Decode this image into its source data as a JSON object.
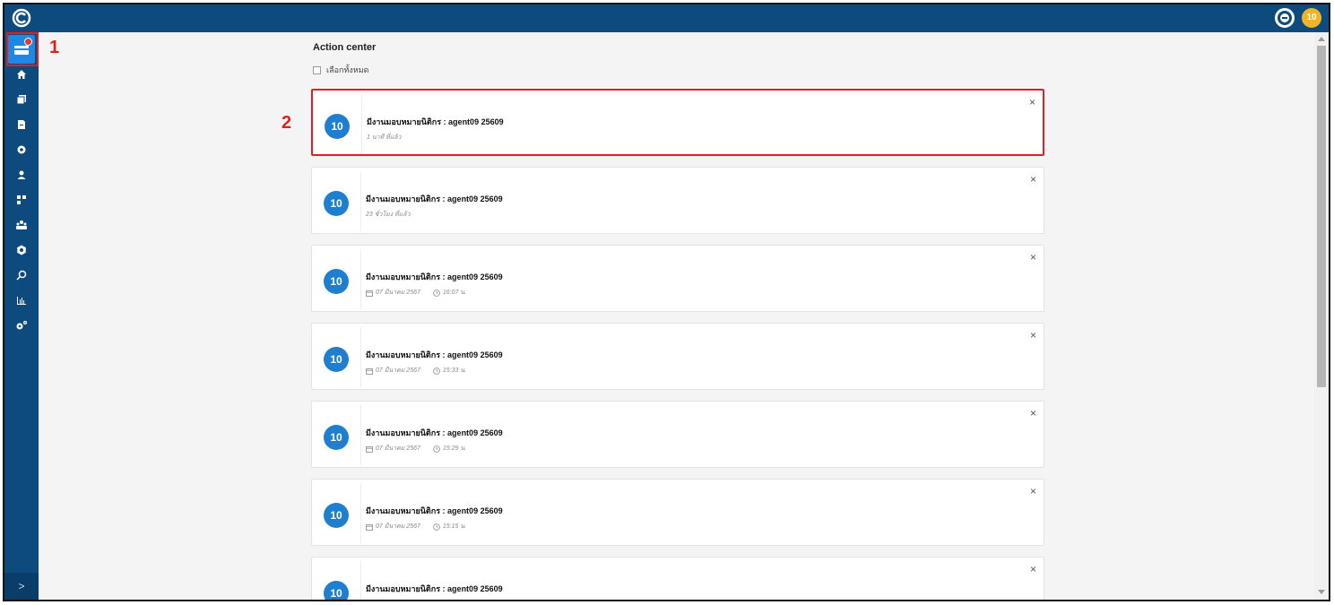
{
  "app": {
    "logo_letter": "C",
    "user_initials": "10"
  },
  "sidebar": {
    "items": [
      {
        "icon": "inbox-icon"
      },
      {
        "icon": "home-icon"
      },
      {
        "icon": "copy-icon"
      },
      {
        "icon": "file-icon"
      },
      {
        "icon": "settings-cog-icon"
      },
      {
        "icon": "user-icon"
      },
      {
        "icon": "grid-icon"
      },
      {
        "icon": "group-icon"
      },
      {
        "icon": "gear-icon"
      },
      {
        "icon": "search-icon"
      },
      {
        "icon": "chart-icon"
      },
      {
        "icon": "cogs-icon"
      }
    ],
    "expand_label": ">"
  },
  "annotations": {
    "label1": "1",
    "label2": "2"
  },
  "main": {
    "title": "Action center",
    "select_all_label": "เลือกทั้งหมด",
    "close_symbol": "×",
    "cards": [
      {
        "avatar": "10",
        "title": "มีงานมอบหมายนิติกร : agent09 25609",
        "time_ago": "1 นาที ที่แล้ว",
        "date": "",
        "time": ""
      },
      {
        "avatar": "10",
        "title": "มีงานมอบหมายนิติกร : agent09 25609",
        "time_ago": "23 ชั่วโมง ที่แล้ว",
        "date": "",
        "time": ""
      },
      {
        "avatar": "10",
        "title": "มีงานมอบหมายนิติกร : agent09 25609",
        "time_ago": "",
        "date": "07 มีนาคม 2567",
        "time": "16:07 น."
      },
      {
        "avatar": "10",
        "title": "มีงานมอบหมายนิติกร : agent09 25609",
        "time_ago": "",
        "date": "07 มีนาคม 2567",
        "time": "15:33 น."
      },
      {
        "avatar": "10",
        "title": "มีงานมอบหมายนิติกร : agent09 25609",
        "time_ago": "",
        "date": "07 มีนาคม 2567",
        "time": "15:29 น."
      },
      {
        "avatar": "10",
        "title": "มีงานมอบหมายนิติกร : agent09 25609",
        "time_ago": "",
        "date": "07 มีนาคม 2567",
        "time": "15:15 น."
      },
      {
        "avatar": "10",
        "title": "มีงานมอบหมายนิติกร : agent09 25609",
        "time_ago": "",
        "date": "",
        "time": ""
      }
    ]
  },
  "colors": {
    "topbar": "#0d4a7e",
    "accent": "#1e88e5",
    "highlight": "#e02020",
    "user_avatar": "#f0b429"
  }
}
